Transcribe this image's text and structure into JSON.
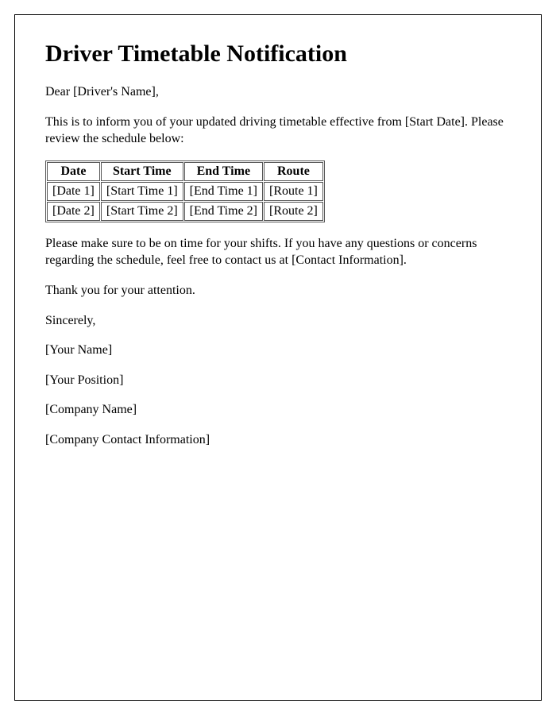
{
  "title": "Driver Timetable Notification",
  "greeting": "Dear [Driver's Name],",
  "intro": "This is to inform you of your updated driving timetable effective from [Start Date]. Please review the schedule below:",
  "table": {
    "headers": {
      "date": "Date",
      "start_time": "Start Time",
      "end_time": "End Time",
      "route": "Route"
    },
    "rows": [
      {
        "date": "[Date 1]",
        "start_time": "[Start Time 1]",
        "end_time": "[End Time 1]",
        "route": "[Route 1]"
      },
      {
        "date": "[Date 2]",
        "start_time": "[Start Time 2]",
        "end_time": "[End Time 2]",
        "route": "[Route 2]"
      }
    ]
  },
  "closing_instruction": "Please make sure to be on time for your shifts. If you have any questions or concerns regarding the schedule, feel free to contact us at [Contact Information].",
  "thank_you": "Thank you for your attention.",
  "signoff": "Sincerely,",
  "signature": {
    "name": "[Your Name]",
    "position": "[Your Position]",
    "company": "[Company Name]",
    "contact": "[Company Contact Information]"
  }
}
